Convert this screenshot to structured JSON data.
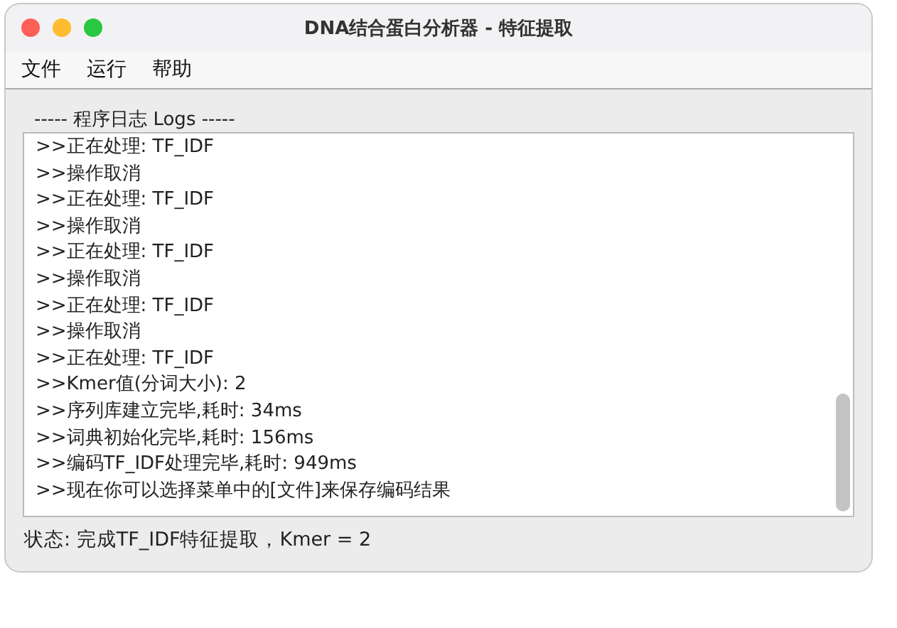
{
  "window": {
    "title": "DNA结合蛋白分析器 - 特征提取"
  },
  "menu": [
    "文件",
    "运行",
    "帮助"
  ],
  "log_panel": {
    "title": "----- 程序日志 Logs -----",
    "lines": [
      ">>正在处理: TF_IDF",
      ">>操作取消",
      ">>正在处理: TF_IDF",
      ">>操作取消",
      ">>正在处理: TF_IDF",
      ">>操作取消",
      ">>正在处理: TF_IDF",
      ">>操作取消",
      ">>正在处理: TF_IDF",
      ">>Kmer值(分词大小):  2",
      ">>序列库建立完毕,耗时: 34ms",
      ">>词典初始化完毕,耗时: 156ms",
      ">>编码TF_IDF处理完毕,耗时: 949ms",
      ">>现在你可以选择菜单中的[文件]来保存编码结果"
    ]
  },
  "status_bar": "状态: 完成TF_IDF特征提取，Kmer = 2"
}
